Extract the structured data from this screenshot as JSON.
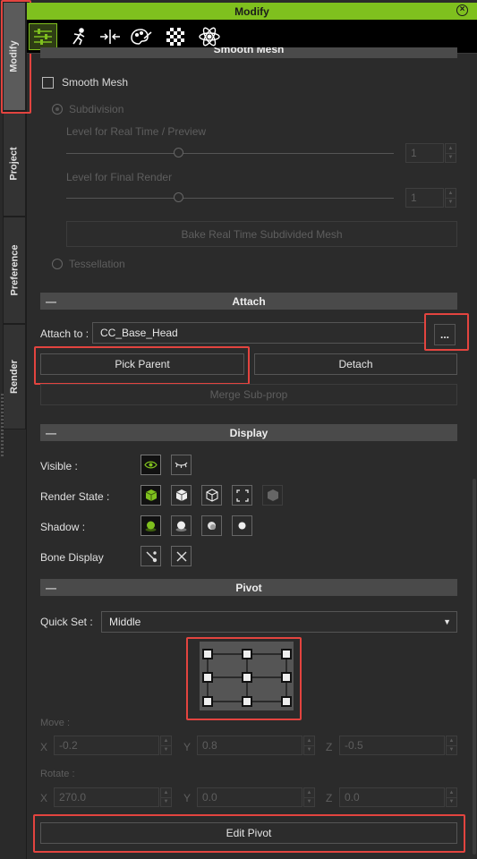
{
  "side_tabs": [
    "Modify",
    "Project",
    "Preference",
    "Render"
  ],
  "window": {
    "title": "Modify",
    "close_icon": "close-circle-icon"
  },
  "toolbar": {
    "tools": [
      {
        "name": "modify-settings-icon",
        "selected": true
      },
      {
        "name": "motion-pose-icon",
        "selected": false
      },
      {
        "name": "align-icon",
        "selected": false
      },
      {
        "name": "material-icon",
        "selected": false
      },
      {
        "name": "texture-checker-icon",
        "selected": false
      },
      {
        "name": "physics-atom-icon",
        "selected": false
      }
    ]
  },
  "smooth_mesh": {
    "section_title": "Smooth Mesh",
    "checkbox_label": "Smooth Mesh",
    "subdivision_label": "Subdivision",
    "realtime_label": "Level for Real Time / Preview",
    "realtime_value": "1",
    "final_label": "Level for Final Render",
    "final_value": "1",
    "bake_button": "Bake Real Time Subdivided Mesh",
    "tessellation_label": "Tessellation"
  },
  "attach": {
    "section_title": "Attach",
    "attach_to_label": "Attach to :",
    "attach_to_value": "CC_Base_Head",
    "browse_button": "...",
    "pick_parent_button": "Pick Parent",
    "detach_button": "Detach",
    "merge_button": "Merge Sub-prop"
  },
  "display": {
    "section_title": "Display",
    "visible_label": "Visible :",
    "render_state_label": "Render State  :",
    "shadow_label": "Shadow :",
    "bone_display_label": "Bone Display",
    "accent_color": "#7fc01e"
  },
  "pivot": {
    "section_title": "Pivot",
    "quick_set_label": "Quick Set :",
    "quick_set_value": "Middle",
    "move_label": "Move :",
    "move": {
      "x": "-0.2",
      "y": "0.8",
      "z": "-0.5"
    },
    "rotate_label": "Rotate :",
    "rotate": {
      "x": "270.0",
      "y": "0.0",
      "z": "0.0"
    },
    "axis_x": "X",
    "axis_y": "Y",
    "axis_z": "Z",
    "edit_pivot_button": "Edit Pivot"
  },
  "highlight_color": "#e3443f"
}
